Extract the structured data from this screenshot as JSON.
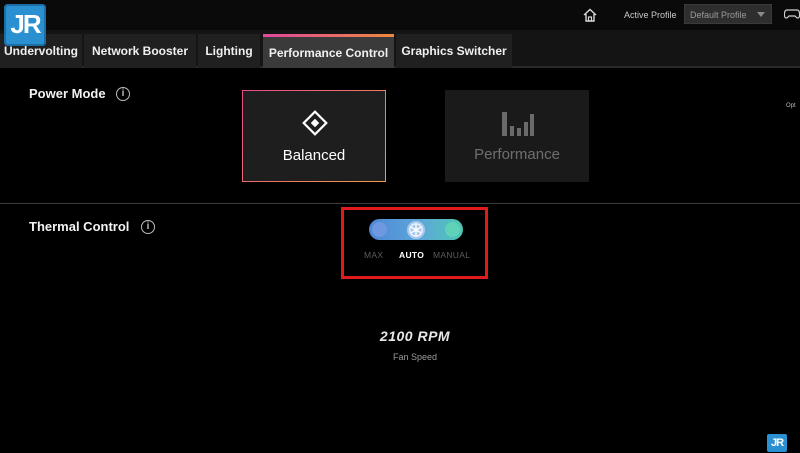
{
  "header": {
    "logo_text": "JR",
    "active_profile_label": "Active Profile",
    "profile_value": "Default Profile"
  },
  "tabs": [
    {
      "label": "Undervolting"
    },
    {
      "label": "Network Booster"
    },
    {
      "label": "Lighting"
    },
    {
      "label": "Performance Control",
      "active": true
    },
    {
      "label": "Graphics Switcher"
    }
  ],
  "power_mode": {
    "title": "Power Mode",
    "info": "i",
    "modes": [
      {
        "label": "Balanced",
        "icon": "diamond-icon",
        "selected": true
      },
      {
        "label": "Performance",
        "icon": "bars-icon",
        "selected": false
      }
    ],
    "side_text": "Opt"
  },
  "thermal_control": {
    "title": "Thermal Control",
    "info": "i",
    "options": [
      "MAX",
      "AUTO",
      "MANUAL"
    ],
    "selected": "AUTO",
    "icon": "fan-icon"
  },
  "fan": {
    "speed": "2100 RPM",
    "label": "Fan Speed"
  },
  "watermark_text": "JR",
  "colors": {
    "accent_pink": "#e94b8c",
    "accent_orange": "#f39c44",
    "highlight_red": "#e01b1b",
    "slider_blue": "#4f86d8",
    "slider_teal": "#4fc7b3"
  }
}
